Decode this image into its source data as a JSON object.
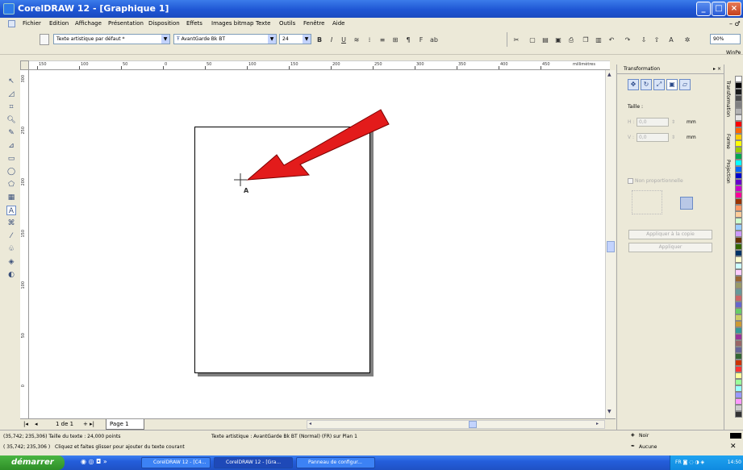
{
  "window": {
    "title": "CorelDRAW 12 - [Graphique 1]"
  },
  "menu": [
    "Fichier",
    "Edition",
    "Affichage",
    "Présentation",
    "Disposition",
    "Effets",
    "Images bitmap",
    "Texte",
    "Outils",
    "Fenêtre",
    "Aide"
  ],
  "toolbar": {
    "text_style": "Texte artistique par défaut *",
    "font_name": "AvantGarde Bk BT",
    "font_size": "24",
    "zoom": "90%",
    "right_label": "WinPe"
  },
  "ruler": {
    "h_ticks": [
      "150",
      "100",
      "50",
      "0",
      "50",
      "100",
      "150",
      "200",
      "250",
      "300",
      "350",
      "400",
      "450"
    ],
    "unit": "millimètres",
    "v_ticks": [
      "300",
      "250",
      "200",
      "150",
      "100",
      "50",
      "0"
    ]
  },
  "pagebar": {
    "counter": "1 de 1",
    "tab": "Page 1"
  },
  "docker": {
    "title": "Transformation",
    "size_label": "Taille :",
    "h_label": "H :",
    "h_value": "0,0",
    "v_label": "V :",
    "v_value": "0,0",
    "unit": "mm",
    "proportional": "Non proportionnelle",
    "apply_copy": "Appliquer à la copie",
    "apply": "Appliquer",
    "tabs": [
      "Transformation",
      "Forme",
      "Projection"
    ]
  },
  "status": {
    "line1_left": "(35,742; 235,306)  Taille du texte : 24,000 points",
    "line1_mid": "Texte artistique : AvantGarde Bk BT (Normal) (FR) sur Plan 1",
    "line2_left": "( 35,742; 235,306 )",
    "line2_hint": "Cliquez et faites glisser pour ajouter du texte courant",
    "fill": "Noir",
    "outline": "Aucune"
  },
  "taskbar": {
    "start": "démarrer",
    "tasks": [
      "CorelDRAW 12 - [C4...",
      "CorelDRAW 12 - [Gra...",
      "Panneau de configur..."
    ],
    "clock": "14:50"
  },
  "palette_colors": [
    "#ffffff",
    "#000000",
    "#1a1a1a",
    "#4d4d4d",
    "#808080",
    "#b3b3b3",
    "#e6e6e6",
    "#ff0000",
    "#ff6600",
    "#ffcc00",
    "#ffff00",
    "#99cc00",
    "#00a651",
    "#00ffff",
    "#0066ff",
    "#0000cc",
    "#6600cc",
    "#cc00cc",
    "#ff0099",
    "#993300",
    "#ff9966",
    "#ffcc99",
    "#ccffcc",
    "#99ccff",
    "#cc99ff",
    "#663300",
    "#336600",
    "#003366",
    "#ffffcc",
    "#ccffff",
    "#ffccff",
    "#996633",
    "#999966",
    "#669999",
    "#cc6666",
    "#6666cc",
    "#66cc66",
    "#cccc66",
    "#cc9933",
    "#339999",
    "#993399",
    "#996666",
    "#666699",
    "#336633",
    "#cc3300",
    "#ff3333",
    "#ffff99",
    "#99ff99",
    "#99ffff",
    "#9999ff",
    "#ff99ff",
    "#cccccc",
    "#333333"
  ],
  "arrow_color": "#e31b1b"
}
